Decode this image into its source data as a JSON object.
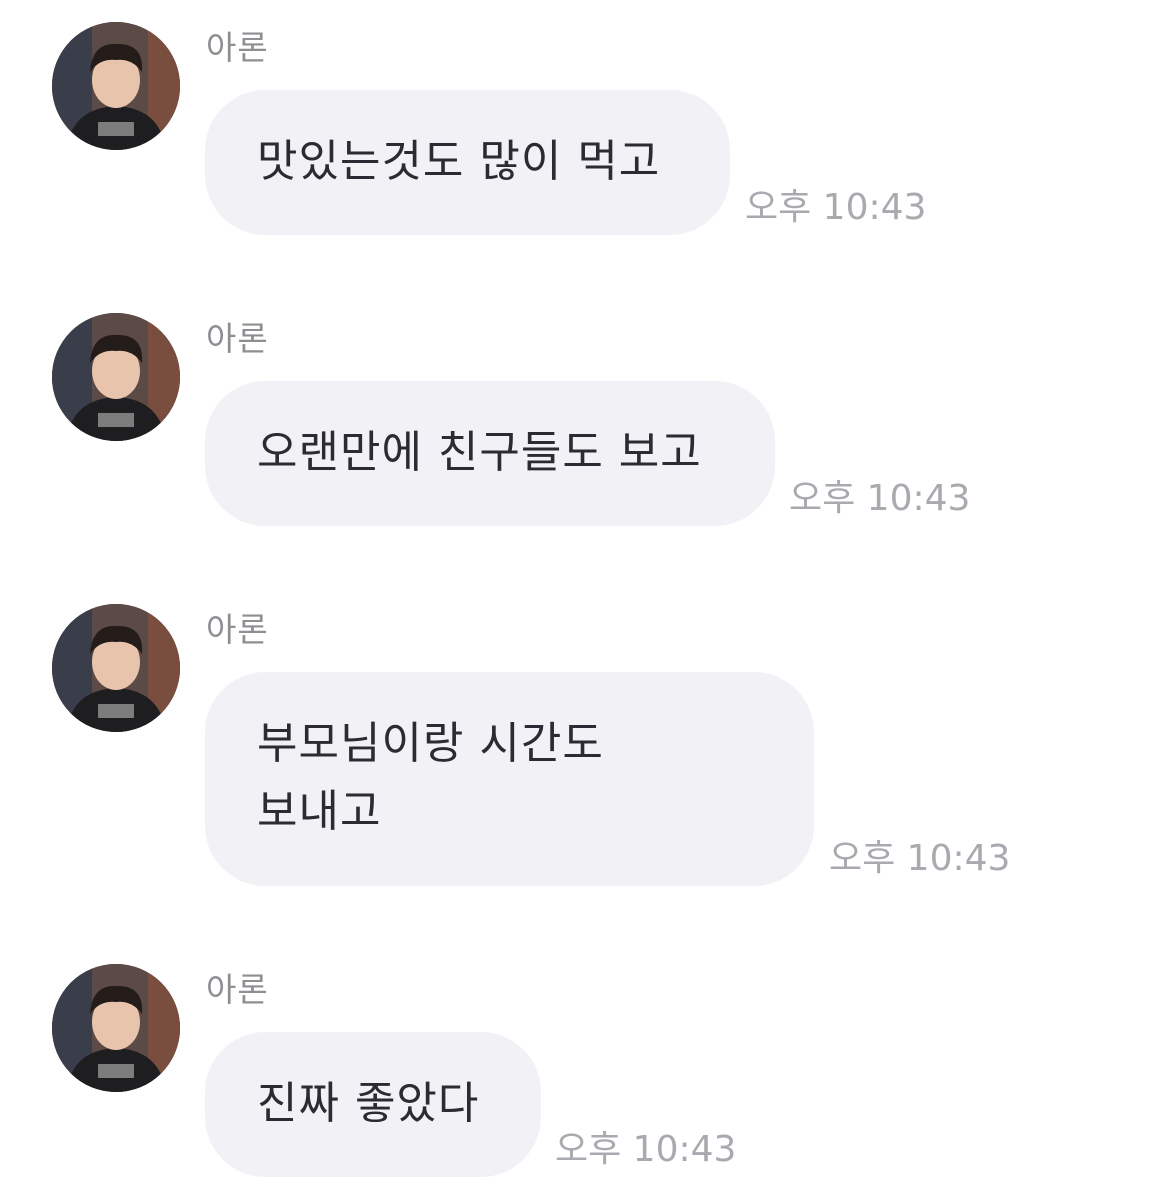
{
  "messages": [
    {
      "sender": "아론",
      "lines": [
        "맛있는것도 많이 먹고"
      ],
      "time": "오후 10:43",
      "avatar_icon": "user-photo-avatar"
    },
    {
      "sender": "아론",
      "lines": [
        "오랜만에 친구들도 보고"
      ],
      "time": "오후 10:43",
      "avatar_icon": "user-photo-avatar"
    },
    {
      "sender": "아론",
      "lines": [
        "부모님이랑 시간도",
        "보내고"
      ],
      "time": "오후 10:43",
      "avatar_icon": "user-photo-avatar"
    },
    {
      "sender": "아론",
      "lines": [
        "진짜 좋았다"
      ],
      "time": "오후 10:43",
      "avatar_icon": "user-photo-avatar"
    }
  ],
  "colors": {
    "background": "#ffffff",
    "bubble": "#f2f2f6",
    "message_text": "#2b2b33",
    "sender_text": "#8e8e93",
    "time_text": "#a9a9b0"
  }
}
